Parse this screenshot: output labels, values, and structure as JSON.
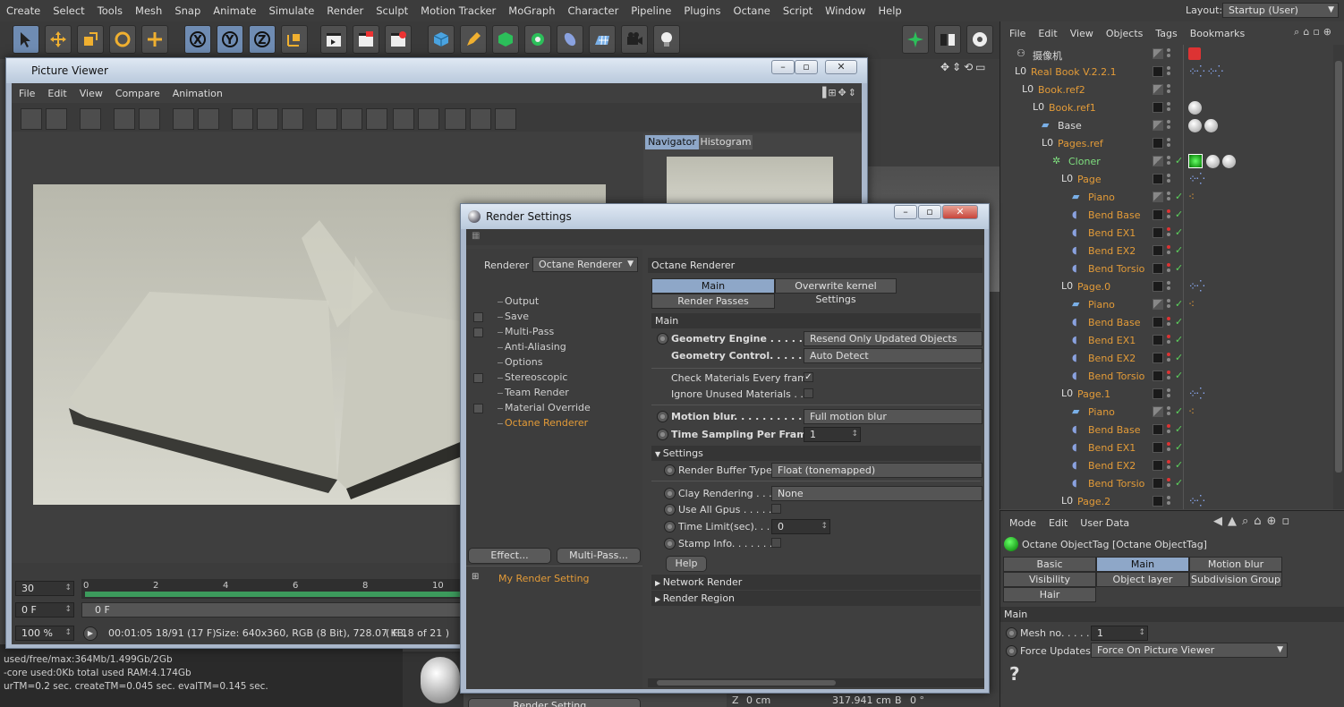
{
  "app": {
    "menu": [
      "Create",
      "Select",
      "Tools",
      "Mesh",
      "Snap",
      "Animate",
      "Simulate",
      "Render",
      "Sculpt",
      "Motion Tracker",
      "MoGraph",
      "Character",
      "Pipeline",
      "Plugins",
      "Octane",
      "Script",
      "Window",
      "Help"
    ],
    "layout_label": "Layout:",
    "layout_value": "Startup (User)"
  },
  "object_manager": {
    "menu": [
      "File",
      "Edit",
      "View",
      "Objects",
      "Tags",
      "Bookmarks"
    ],
    "rows": [
      {
        "name": "摄像机",
        "color": "#dcdcdc"
      },
      {
        "name": "Real Book V.2.2.1",
        "color": "#e39b38"
      },
      {
        "name": "Book.ref2",
        "color": "#e39b38"
      },
      {
        "name": "Book.ref1",
        "color": "#e39b38"
      },
      {
        "name": "Base",
        "color": "#dcdcdc"
      },
      {
        "name": "Pages.ref",
        "color": "#e39b38"
      },
      {
        "name": "Cloner",
        "color": "#7fe07f"
      },
      {
        "name": "Page",
        "color": "#e39b38"
      },
      {
        "name": "Piano",
        "color": "#e39b38"
      },
      {
        "name": "Bend Base",
        "color": "#e39b38"
      },
      {
        "name": "Bend EX1",
        "color": "#e39b38"
      },
      {
        "name": "Bend EX2",
        "color": "#e39b38"
      },
      {
        "name": "Bend Torsio",
        "color": "#e39b38"
      },
      {
        "name": "Page.0",
        "color": "#e39b38"
      },
      {
        "name": "Piano",
        "color": "#e39b38"
      },
      {
        "name": "Bend Base",
        "color": "#e39b38"
      },
      {
        "name": "Bend EX1",
        "color": "#e39b38"
      },
      {
        "name": "Bend EX2",
        "color": "#e39b38"
      },
      {
        "name": "Bend Torsio",
        "color": "#e39b38"
      },
      {
        "name": "Page.1",
        "color": "#e39b38"
      },
      {
        "name": "Piano",
        "color": "#e39b38"
      },
      {
        "name": "Bend Base",
        "color": "#e39b38"
      },
      {
        "name": "Bend EX1",
        "color": "#e39b38"
      },
      {
        "name": "Bend EX2",
        "color": "#e39b38"
      },
      {
        "name": "Bend Torsio",
        "color": "#e39b38"
      },
      {
        "name": "Page.2",
        "color": "#e39b38"
      }
    ]
  },
  "attribute_manager": {
    "menu": [
      "Mode",
      "Edit",
      "User Data"
    ],
    "title": "Octane ObjectTag [Octane ObjectTag]",
    "tabs": [
      "Basic",
      "Main",
      "Motion blur",
      "Visibility",
      "Object layer",
      "Subdivision Group",
      "Hair"
    ],
    "section": "Main",
    "mesh_no_label": "Mesh no. . . . .",
    "mesh_no_value": "1",
    "force_updates_label": "Force Updates",
    "force_updates_value": "Force On Picture Viewer"
  },
  "picture_viewer": {
    "title": "Picture Viewer",
    "menu": [
      "File",
      "Edit",
      "View",
      "Compare",
      "Animation"
    ],
    "side_tabs": [
      "Navigator",
      "Histogram"
    ],
    "frame_value": "30",
    "frame_field": "0 F",
    "timeline_field": "0 F",
    "ruler": [
      "0",
      "2",
      "4",
      "6",
      "8",
      "10"
    ],
    "zoom": "100 %",
    "status_time": "00:01:05 18/91 (17 F)",
    "status_size": "Size: 640x360, RGB (8 Bit), 728.07 KB,",
    "status_frame": "( F 18 of 21 )"
  },
  "console": {
    "lines": [
      "used/free/max:364Mb/1.499Gb/2Gb",
      "-core used:0Kb  total used RAM:4.174Gb",
      "urTM=0.2 sec.   createTM=0.045 sec.   evalTM=0.145 sec."
    ]
  },
  "coords": {
    "z_label": "Z",
    "z_value": "0 cm",
    "mid": "317.941 cm",
    "b_label": "B",
    "b_value": "0 °"
  },
  "render_settings": {
    "title": "Render Settings",
    "renderer_label": "Renderer",
    "renderer_value": "Octane Renderer",
    "list": [
      "Output",
      "Save",
      "Multi-Pass",
      "Anti-Aliasing",
      "Options",
      "Stereoscopic",
      "Team Render",
      "Material Override",
      "Octane Renderer"
    ],
    "effect_button": "Effect...",
    "multipass_button": "Multi-Pass...",
    "preset": "My Render Setting",
    "render_setting_button": "Render Setting...",
    "panel_title": "Octane Renderer",
    "tab_main": "Main",
    "tab_overwrite": "Overwrite kernel Settings",
    "tab_passes": "Render Passes",
    "section_main": "Main",
    "geometry_engine_label": "Geometry Engine . . . . . . . .",
    "geometry_engine_value": "Resend Only Updated Objects",
    "geometry_control_label": "Geometry Control. . . . . . . .",
    "geometry_control_value": "Auto Detect",
    "check_materials": "Check Materials Every frame",
    "check_mark": "✓",
    "ignore_materials": "Ignore Unused Materials . .",
    "motion_blur_label": "Motion blur. . . . . . . . . . . . .",
    "motion_blur_value": "Full motion blur",
    "time_sampling_label": "Time Sampling Per Frames",
    "time_sampling_value": "1",
    "settings_section": "Settings",
    "render_buffer_label": "Render Buffer Type",
    "render_buffer_value": "Float (tonemapped)",
    "clay_label": "Clay Rendering . . .",
    "clay_value": "None",
    "use_all_gpus": "Use All Gpus . . . . .",
    "time_limit_label": "Time Limit(sec). . . .",
    "time_limit_value": "0",
    "stamp_info": "Stamp Info. . . . . . .",
    "help_button": "Help",
    "network_render": "Network Render",
    "render_region": "Render Region"
  }
}
